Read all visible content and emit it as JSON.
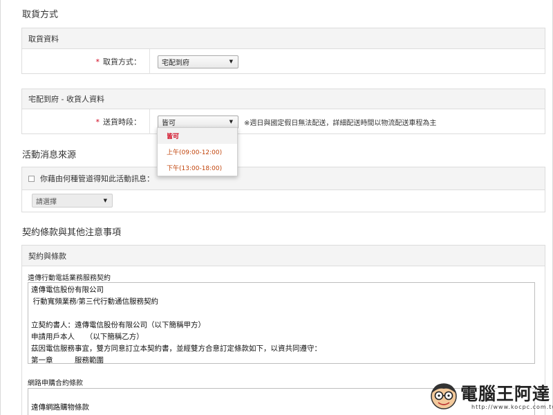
{
  "pickup": {
    "title": "取貨方式",
    "panel_head": "取貨資料",
    "method_label": "取貨方式：",
    "method_value": "宅配到府"
  },
  "delivery": {
    "panel_head": "宅配到府 - 收貨人資料",
    "time_label": "送貨時段：",
    "time_value": "皆可",
    "note": "※週日與國定假日無法配送，詳細配送時間以物流配送車程為主",
    "options": [
      {
        "label": "皆可",
        "selected": true
      },
      {
        "label": "上午(09:00-12:00)",
        "selected": false
      },
      {
        "label": "下午(13:00-18:00)",
        "selected": false
      }
    ]
  },
  "activity": {
    "title": "活動消息來源",
    "question": "你藉由何種管道得知此活動訊息：",
    "select_placeholder": "請選擇"
  },
  "terms": {
    "title": "契約條款與其他注意事項",
    "panel_head": "契約與條款",
    "contract1_title": "遠傳行動電話業務服務契約",
    "contract1_lines": [
      "遠傳電信股份有限公司",
      " 行動寬頻業務/第三代行動通信服務契約",
      "",
      "立契約書人：遠傳電信股份有限公司（以下簡稱甲方）",
      "申請用戶本人　　（以下簡稱乙方）",
      "茲因電信服務事宜，雙方同意訂立本契約書，並經雙方合意訂定條款如下，以資共同遵守：",
      "第一章　　　服務範圍"
    ],
    "contract2_title": "網路申購合約條款",
    "contract2_lines": [
      "",
      "遠傳網路購物條款"
    ]
  },
  "watermark": {
    "text": "電腦王阿達",
    "url": "http://www.kocpc.com.tw"
  },
  "colors": {
    "required": "#d0021b",
    "option_text": "#c0430a",
    "panel_head_bg": "#f4f4f4"
  }
}
